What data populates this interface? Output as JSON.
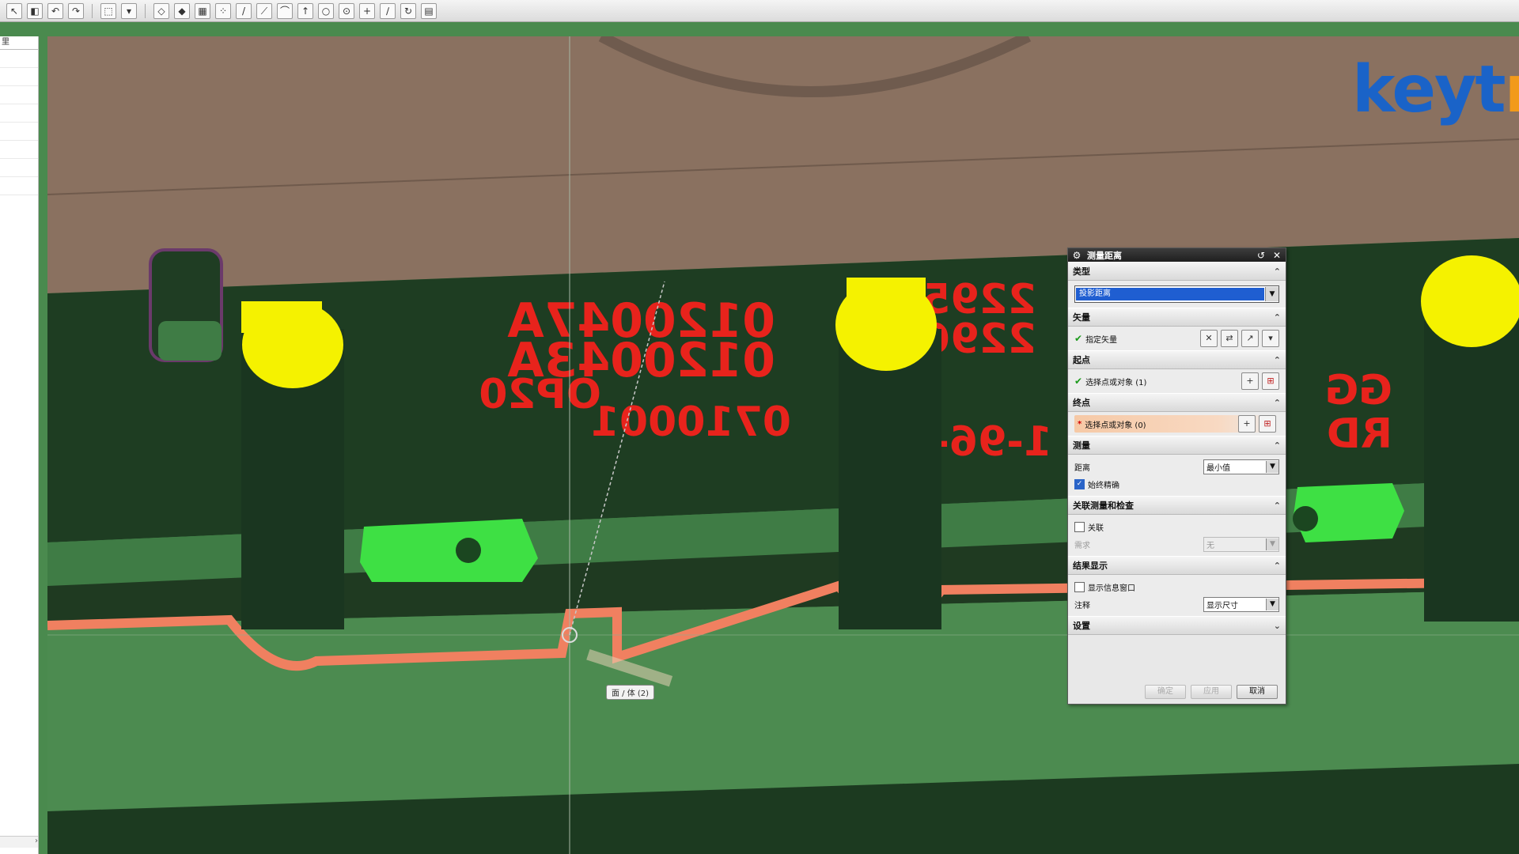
{
  "toolbar": {
    "icons": [
      "select-arrow-icon",
      "snap-icon",
      "undo-icon",
      "redo-icon",
      "box-select-icon",
      "dropdown-icon",
      "cube-wire-icon",
      "cube-solid-icon",
      "grid-icon",
      "snap-points-icon",
      "line-icon",
      "line-icon-2",
      "curve-icon",
      "arrow-icon",
      "circle-icon",
      "circle-center-icon",
      "plus-icon",
      "slash-icon",
      "rotate-icon",
      "document-icon"
    ]
  },
  "sidebar": {
    "header": "里"
  },
  "viewport": {
    "embossed_text": [
      "0120047A",
      "0120043A",
      "OP20",
      "0710001",
      "2295",
      "2296",
      "1-96-",
      "GG",
      "RD"
    ],
    "tooltip": "面 / 体 (2)"
  },
  "logo": {
    "text_main": "keyt",
    "text_accent": "n"
  },
  "dialog": {
    "title": "测量距离",
    "sections": {
      "type": {
        "label": "类型",
        "value": "投影距离"
      },
      "vector": {
        "label": "矢量",
        "item": "指定矢量"
      },
      "start": {
        "label": "起点",
        "item": "选择点或对象 (1)"
      },
      "end": {
        "label": "终点",
        "item": "选择点或对象 (0)"
      },
      "measure": {
        "label": "测量",
        "distance_label": "距离",
        "distance_value": "最小值",
        "check_label": "始终精确",
        "checked": true
      },
      "assoc": {
        "label": "关联测量和检查",
        "assoc_label": "关联",
        "req_label": "需求",
        "req_value": "无"
      },
      "result": {
        "label": "结果显示",
        "info_label": "显示信息窗口",
        "note_label": "注释",
        "note_value": "显示尺寸"
      },
      "settings": {
        "label": "设置"
      }
    },
    "buttons": {
      "ok": "确定",
      "apply": "应用",
      "cancel": "取消"
    }
  },
  "colors": {
    "accent": "#1f5ed1",
    "part_green": "#4a8a4e",
    "pin_yellow": "#f5f200",
    "outline_salmon": "#f08060",
    "text_red": "#e8231c"
  }
}
